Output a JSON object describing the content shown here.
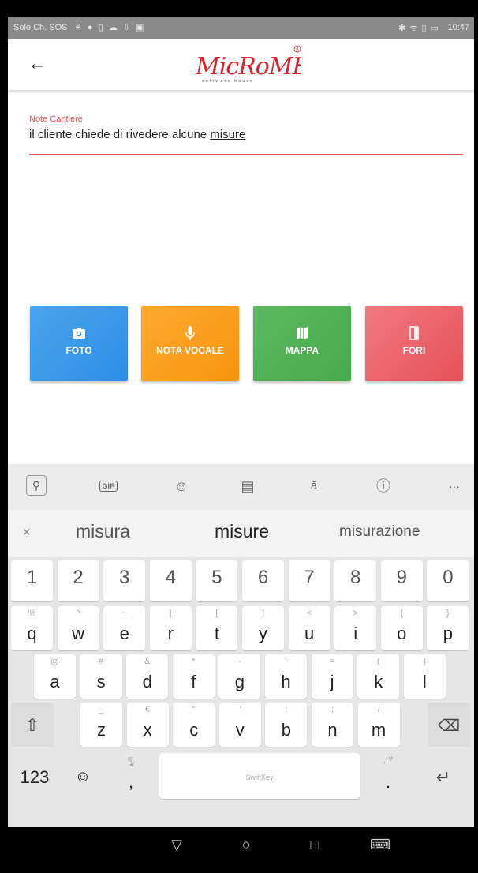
{
  "status_bar": {
    "carrier": "Solo Ch. SOS",
    "left_icons": "⚘ ● ▯ ☁ ⇩ ▣",
    "right_icons": "✱ ᯤ ▯ ▭",
    "time": "10:47"
  },
  "app_bar": {
    "back_icon": "arrow-left-icon",
    "logo_text": "MicRoMEGA",
    "logo_subtitle": "software house",
    "logo_color": "#d9232e"
  },
  "note_field": {
    "label": "Note Cantiere",
    "value_prefix": "il cliente chiede di rivedere alcune ",
    "value_underlined": "misure",
    "accent_color": "#e05555"
  },
  "actions": [
    {
      "label": "FOTO",
      "icon": "camera-icon",
      "color": "#2b8fe8"
    },
    {
      "label": "NOTA VOCALE",
      "icon": "microphone-icon",
      "color": "#f79410"
    },
    {
      "label": "MAPPA",
      "icon": "map-icon",
      "color": "#47aa4b"
    },
    {
      "label": "FORI",
      "icon": "door-icon",
      "color": "#e65058"
    }
  ],
  "keyboard": {
    "toolbar_icons": [
      "search-icon",
      "gif-icon",
      "sticker-icon",
      "clipboard-icon",
      "translate-icon",
      "info-icon",
      "more-icon"
    ],
    "suggestions": [
      "misura",
      "misure",
      "misurazione"
    ],
    "numbers": [
      "1",
      "2",
      "3",
      "4",
      "5",
      "6",
      "7",
      "8",
      "9",
      "0"
    ],
    "row1": [
      {
        "k": "q",
        "a": "%"
      },
      {
        "k": "w",
        "a": "^"
      },
      {
        "k": "e",
        "a": "~"
      },
      {
        "k": "r",
        "a": "|"
      },
      {
        "k": "t",
        "a": "["
      },
      {
        "k": "y",
        "a": "]"
      },
      {
        "k": "u",
        "a": "<"
      },
      {
        "k": "i",
        "a": ">"
      },
      {
        "k": "o",
        "a": "{"
      },
      {
        "k": "p",
        "a": "}"
      }
    ],
    "row2": [
      {
        "k": "a",
        "a": "@"
      },
      {
        "k": "s",
        "a": "#"
      },
      {
        "k": "d",
        "a": "&"
      },
      {
        "k": "f",
        "a": "*"
      },
      {
        "k": "g",
        "a": "-"
      },
      {
        "k": "h",
        "a": "+"
      },
      {
        "k": "j",
        "a": "="
      },
      {
        "k": "k",
        "a": "("
      },
      {
        "k": "l",
        "a": ")"
      }
    ],
    "row3": [
      {
        "k": "z",
        "a": "_"
      },
      {
        "k": "x",
        "a": "€"
      },
      {
        "k": "c",
        "a": "\""
      },
      {
        "k": "v",
        "a": "'"
      },
      {
        "k": "b",
        "a": ":"
      },
      {
        "k": "n",
        "a": ";"
      },
      {
        "k": "m",
        "a": "/"
      }
    ],
    "mode_key": "123",
    "comma_key": ",",
    "period_key": ".",
    "period_alt": ",!?",
    "space_label": "SwiftKey"
  },
  "nav_bar": {
    "back": "▽",
    "home": "○",
    "recents": "□",
    "keyboard": "⌨"
  }
}
